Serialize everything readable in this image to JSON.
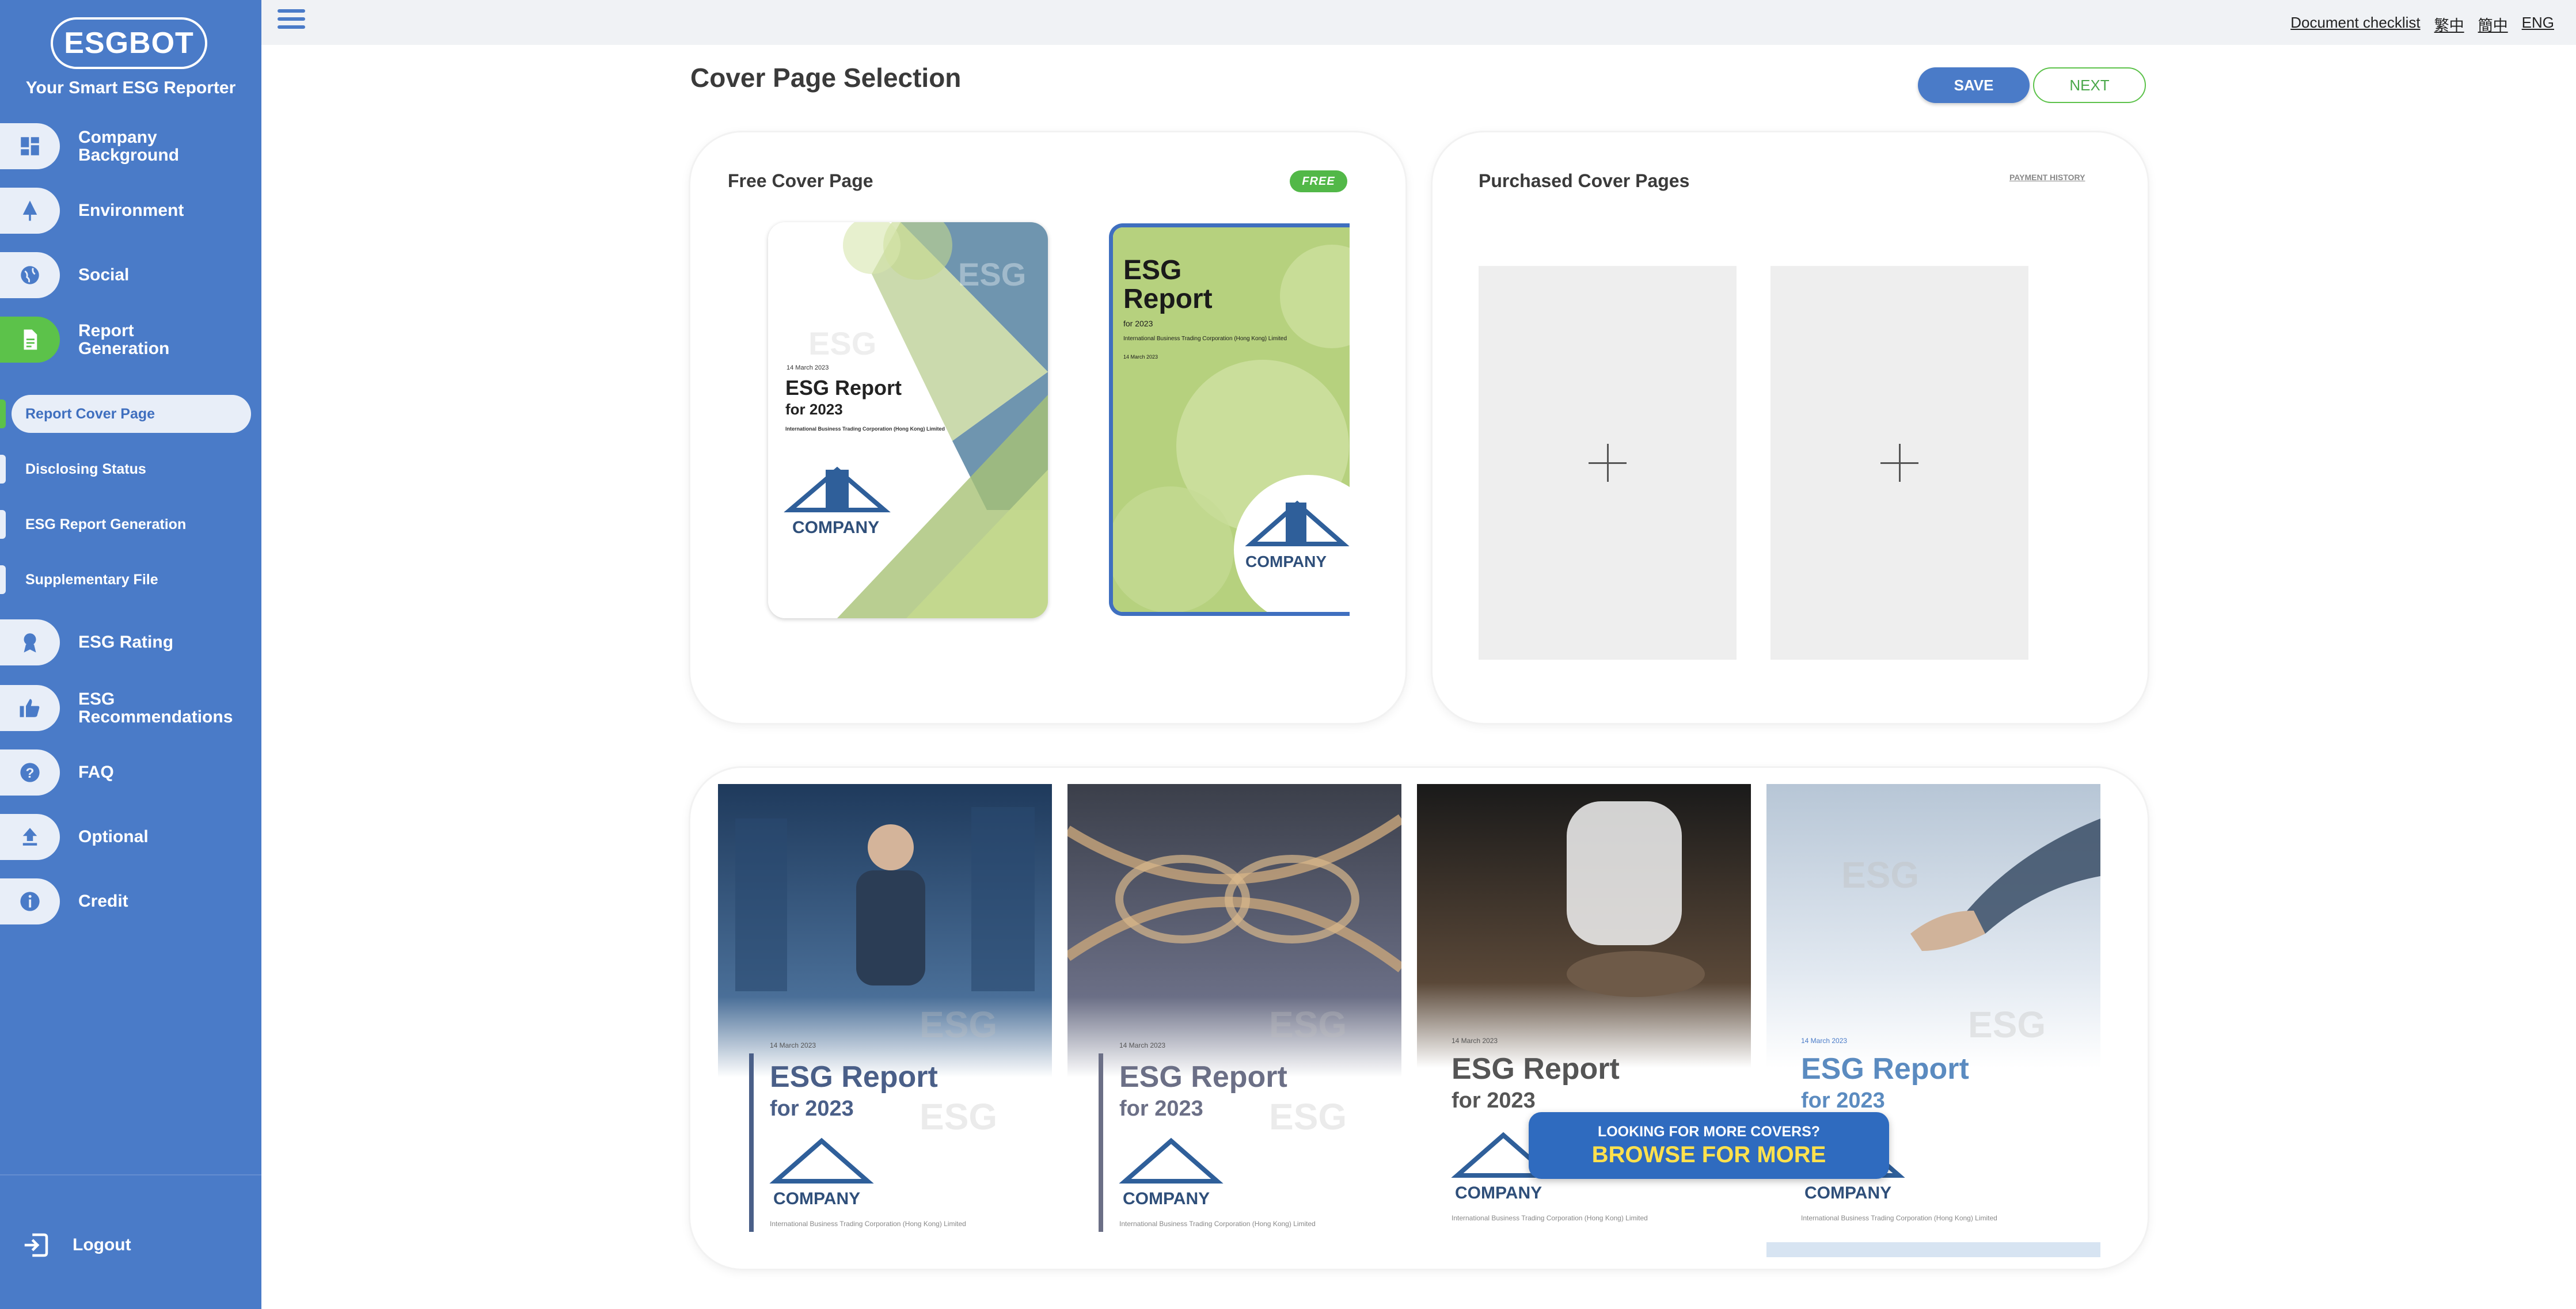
{
  "app": {
    "logo": "ESGBOT",
    "tagline": "Your Smart ESG Reporter"
  },
  "sidebar": {
    "items": [
      {
        "label": "Company\nBackground",
        "icon": "dashboard-icon"
      },
      {
        "label": "Environment",
        "icon": "tree-icon"
      },
      {
        "label": "Social",
        "icon": "globe-icon"
      },
      {
        "label": "Report\nGeneration",
        "icon": "document-icon"
      },
      {
        "label": "ESG Rating",
        "icon": "award-icon"
      },
      {
        "label": "ESG\nRecommendations",
        "icon": "thumbs-up-icon"
      },
      {
        "label": "FAQ",
        "icon": "question-icon"
      },
      {
        "label": "Optional",
        "icon": "upload-icon"
      },
      {
        "label": "Credit",
        "icon": "info-icon"
      }
    ],
    "sub_items": [
      {
        "label": "Report Cover Page",
        "active": true
      },
      {
        "label": "Disclosing Status",
        "active": false
      },
      {
        "label": "ESG Report Generation",
        "active": false
      },
      {
        "label": "Supplementary File",
        "active": false
      }
    ],
    "logout": "Logout"
  },
  "topbar": {
    "links": [
      "Document checklist",
      "繁中",
      "簡中",
      "ENG"
    ]
  },
  "main": {
    "title": "Cover Page Selection",
    "save_label": "SAVE",
    "next_label": "NEXT",
    "free_card": {
      "title": "Free Cover Page",
      "badge": "FREE"
    },
    "purchased_card": {
      "title": "Purchased Cover Pages",
      "payment_history": "PAYMENT HISTORY"
    },
    "cover": {
      "date": "14 March 2023",
      "title": "ESG Report",
      "subtitle": "for 2023",
      "company_full": "International Business Trading Corporation (Hong Kong) Limited",
      "company_logo": "COMPANY",
      "watermark": "ESG"
    },
    "browse": {
      "small": "LOOKING FOR MORE COVERS?",
      "big": "BROWSE FOR MORE"
    }
  },
  "colors": {
    "sidebar": "#4a7bc8",
    "accent_green": "#5cc24a",
    "browse_yellow": "#ffe14d"
  }
}
